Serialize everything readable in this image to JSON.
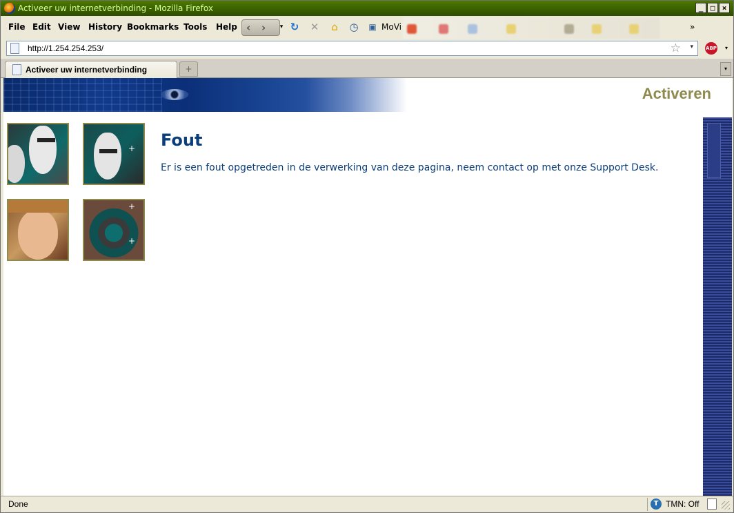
{
  "window": {
    "title": "Activeer uw internetverbinding - Mozilla Firefox",
    "controls": [
      "minimize",
      "maximize",
      "close"
    ]
  },
  "menubar": {
    "items": [
      "File",
      "Edit",
      "View",
      "History",
      "Bookmarks",
      "Tools",
      "Help"
    ],
    "bookmark_first": "MoVi",
    "chevron": "»"
  },
  "urlbar": {
    "url": "http://1.254.254.253/"
  },
  "tabs": [
    {
      "label": "Activeer uw internetverbinding"
    }
  ],
  "page": {
    "banner_heading": "Activeren",
    "error_title": "Fout",
    "error_message": "Er is een fout opgetreden in de verwerking van deze pagina, neem contact op met onze Support Desk."
  },
  "statusbar": {
    "status": "Done",
    "tmn_label": "TMN: Off"
  },
  "colors": {
    "title_bar": "#3a5e00",
    "heading_text": "#0b3e7a",
    "banner_accent": "#8f8a4e"
  },
  "icons": [
    "firefox-icon",
    "back-icon",
    "forward-icon",
    "reload-icon",
    "stop-icon",
    "home-icon",
    "history-icon",
    "bookmark-icon",
    "page-icon",
    "star-icon",
    "adblock-icon",
    "new-tab-icon",
    "tmn-icon"
  ]
}
